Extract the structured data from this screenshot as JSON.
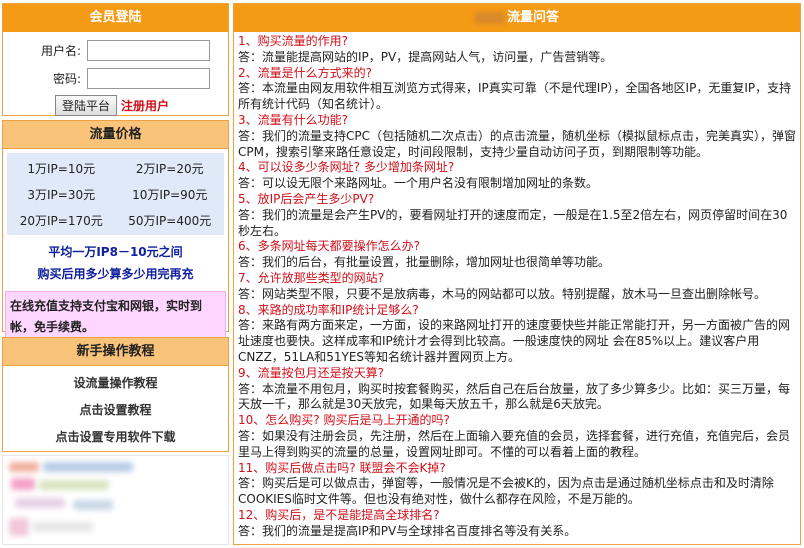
{
  "login": {
    "title": "会员登陆",
    "username_label": "用户名:",
    "password_label": "密码:",
    "submit_label": "登陆平台",
    "register_label": "注册用户"
  },
  "price": {
    "title": "流量价格",
    "rows": [
      [
        "1万IP=10元",
        "2万IP=20元"
      ],
      [
        "3万IP=30元",
        "10万IP=90元"
      ],
      [
        "20万IP=170元",
        "50万IP=400元"
      ]
    ],
    "note1": "平均一万IP8－10元之间",
    "note2": "购买后用多少算多少用完再充",
    "pink": "在线充值支持支付宝和网银，实时到帐，免手续费。"
  },
  "guide": {
    "title": "新手操作教程",
    "items": [
      "设流量操作教程",
      "点击设置教程",
      "点击设置专用软件下载"
    ]
  },
  "faq": {
    "title": "流量问答",
    "items": [
      {
        "q": "1、购买流量的作用?",
        "a": "答：流量能提高网站的IP，PV，提高网站人气，访问量，广告营销等。"
      },
      {
        "q": "2、流量是什么方式来的?",
        "a": "答：本流量由网友用软件相互浏览方式得来，IP真实可靠（不是代理IP），全国各地区IP，无重复IP，支持所有统计代码（知名统计）。"
      },
      {
        "q": "3、流量有什么功能?",
        "a": "答：我们的流量支持CPC（包括随机二次点击）的点击流量，随机坐标（模拟鼠标点击，完美真实），弹窗CPM，搜索引擎来路任意设定，时间段限制，支持少量自动访问子页，到期限制等功能。"
      },
      {
        "q": "4、可以设多少条网址? 多少增加条网址?",
        "a": "答：可以设无限个来路网址。一个用户名没有限制增加网址的条数。"
      },
      {
        "q": "5、放IP后会产生多少PV?",
        "a": "答：我们的流量是会产生PV的，要看网址打开的速度而定，一般是在1.5至2倍左右，网页停留时间在30秒左右。"
      },
      {
        "q": "6、多条网址每天都要操作怎么办?",
        "a": "答：我们的后台，有批量设置，批量删除，增加网址也很简单等功能。"
      },
      {
        "q": "7、允许放那些类型的网站?",
        "a": "答：网站类型不限，只要不是放病毒，木马的网站都可以放。特别提醒，放木马一旦查出删除帐号。"
      },
      {
        "q": "8、来路的成功率和IP统计足够么?",
        "a": "答：来路有两方面来定，一方面，设的来路网址打开的速度要快些并能正常能打开，另一方面被广告的网址速度也要快。这样成率和IP统计才会得到比较高。一般速度快的网址 会在85%以上。建议客户用CNZZ，51LA和51YES等知名统计器并置网页上方。"
      },
      {
        "q": "9、流量按包月还是按天算?",
        "a": "答：本流量不用包月，购买时按套餐购买，然后自己在后台放量，放了多少算多少。比如：买三万量，每天放一千，那么就是30天放完，如果每天放五千，那么就是6天放完。"
      },
      {
        "q": "10、怎么购买? 购买后是马上开通的吗?",
        "a": "答：如果没有注册会员，先注册，然后在上面输入要充值的会员，选择套餐，进行充值，充值完后，会员里马上得到购买的流量的总量，设置网址即可。不懂的可以看着上面的教程。"
      },
      {
        "q": "11、购买后做点击吗? 联盟会不会K掉?",
        "a": "答：购买后是可以做点击，弹窗等，一般情况是不会被K的，因为点击是通过随机坐标点击和及时清除COOKIES临时文件等。但也没有绝对性，做什么都存在风险，不是万能的。"
      },
      {
        "q": "12、购买后，是不是能提高全球排名?",
        "a": "答：我们的流量是提高IP和PV与全球排名百度排名等没有关系。"
      }
    ]
  },
  "colors": {
    "accent": "#f59a14",
    "question": "#d0101a",
    "note_blue": "#1020a0",
    "price_bg": "#dfe9f7",
    "pink_bg": "#ffd6ff"
  }
}
